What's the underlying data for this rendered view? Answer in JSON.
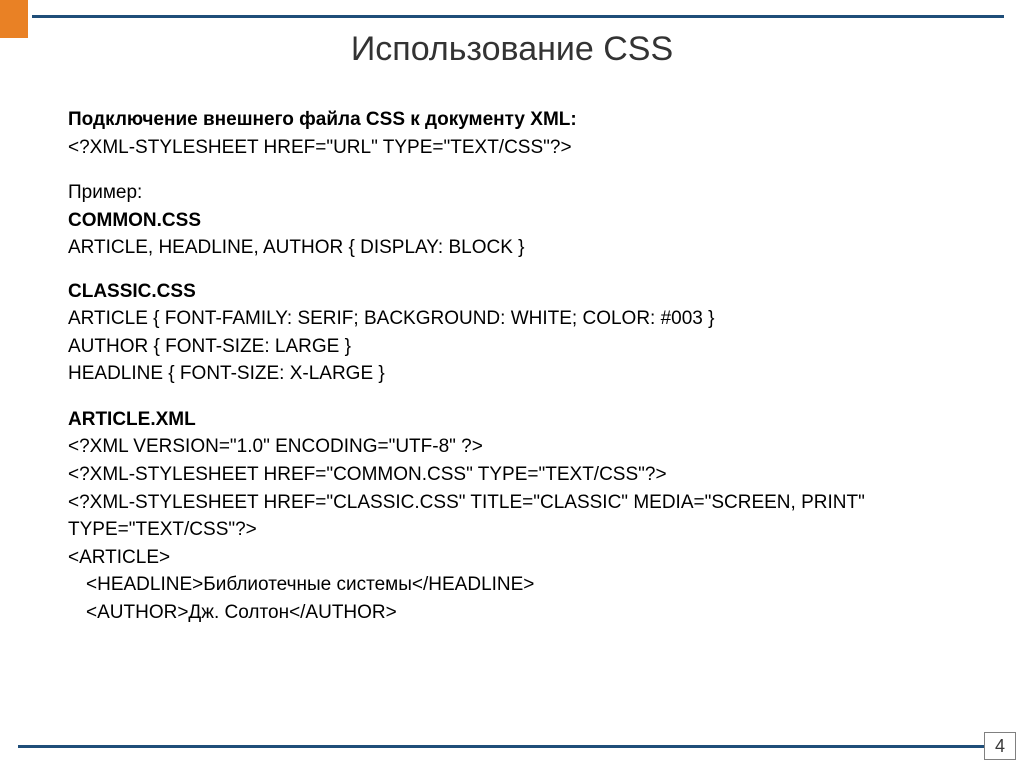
{
  "title": "Использование CSS",
  "header": {
    "heading": "Подключение внешнего файла CSS к документу XML:",
    "pi": "<?xml-stylesheet href=\"URL\" type=\"text/css\"?>"
  },
  "example_label": "Пример:",
  "common": {
    "name": "common.css",
    "rule": "article, headline, author { display: block }"
  },
  "classic": {
    "name": "classic.css",
    "r1": "article { font-family: serif; background: white; color: #003 }",
    "r2": "author { font-size: large }",
    "r3": "headline { font-size: x-large }"
  },
  "article": {
    "name": "article.xml",
    "l1": "<?xml version=\"1.0\" encoding=\"UTF-8\" ?>",
    "l2": "<?xml-stylesheet href=\"common.css\" type=\"text/css\"?>",
    "l3": "<?xml-stylesheet href=\"classic.css\" title=\"Classic\" media=\"screen, print\" type=\"text/css\"?>",
    "l4": "<article>",
    "l5_open": "<headline>",
    "l5_text": "Библиотечные системы",
    "l5_close": "</headline>",
    "l6_open": "<author>",
    "l6_text": "Дж. Солтон",
    "l6_close": "</author>"
  },
  "page_number": "4"
}
